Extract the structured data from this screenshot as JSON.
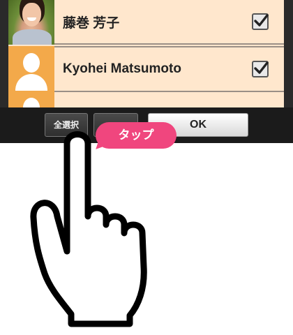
{
  "contacts": [
    {
      "name": "藤巻 芳子",
      "avatar": "photo-avatar",
      "checked": true
    },
    {
      "name": "Kyohei Matsumoto",
      "avatar": "default-avatar",
      "checked": true
    },
    {
      "name": "",
      "avatar": "default-avatar",
      "checked": false
    }
  ],
  "toolbar": {
    "select_all_label": "全選択",
    "release_label": "",
    "ok_label": "OK"
  },
  "annotation": {
    "tap_label": "タップ"
  },
  "colors": {
    "row_bg": "#ffe7cd",
    "default_avatar": "#f3a94a",
    "bubble": "#f0467e",
    "toolbar": "#1b1b1b"
  },
  "icons": {
    "checkbox": "checkbox-checked-icon",
    "hand": "hand-pointer-icon"
  }
}
